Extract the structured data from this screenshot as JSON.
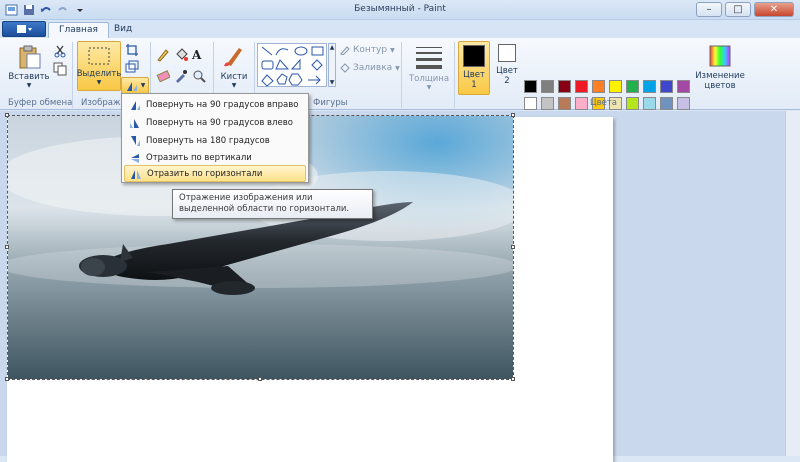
{
  "window": {
    "title": "Безымянный - Paint"
  },
  "tabs": {
    "home": "Главная",
    "view": "Вид"
  },
  "groups": {
    "clipboard": "Буфер обмена",
    "image": "Изображ",
    "shapes": "Фигуры",
    "colors": "Цвета"
  },
  "clipboard": {
    "paste": "Вставить"
  },
  "image": {
    "select": "Выделить"
  },
  "tools": {
    "brushes": "Кисти"
  },
  "shapes": {
    "outline": "Контур",
    "fill": "Заливка"
  },
  "size": {
    "label": "Толщина"
  },
  "color1": {
    "label": "Цвет",
    "num": "1",
    "value": "#000000"
  },
  "color2": {
    "label": "Цвет",
    "num": "2",
    "value": "#ffffff"
  },
  "edit_colors": {
    "line1": "Изменение",
    "line2": "цветов"
  },
  "palette": {
    "row1": [
      "#000000",
      "#7f7f7f",
      "#880015",
      "#ed1c24",
      "#ff7f27",
      "#fff200",
      "#22b14c",
      "#00a2e8",
      "#3f48cc",
      "#a349a4"
    ],
    "row2": [
      "#ffffff",
      "#c3c3c3",
      "#b97a57",
      "#ffaec9",
      "#ffc90e",
      "#efe4b0",
      "#b5e61d",
      "#99d9ea",
      "#7092be",
      "#c8bfe7"
    ]
  },
  "rotate_menu": {
    "items": [
      {
        "label": "Повернуть на 90 градусов вправо"
      },
      {
        "label": "Повернуть на 90 градусов влево"
      },
      {
        "label": "Повернуть на 180 градусов"
      },
      {
        "label": "Отразить по вертикали"
      },
      {
        "label": "Отразить по горизонтали"
      }
    ]
  },
  "tooltip": {
    "line1": "Отражение изображения или",
    "line2": "выделенной области по горизонтали."
  }
}
